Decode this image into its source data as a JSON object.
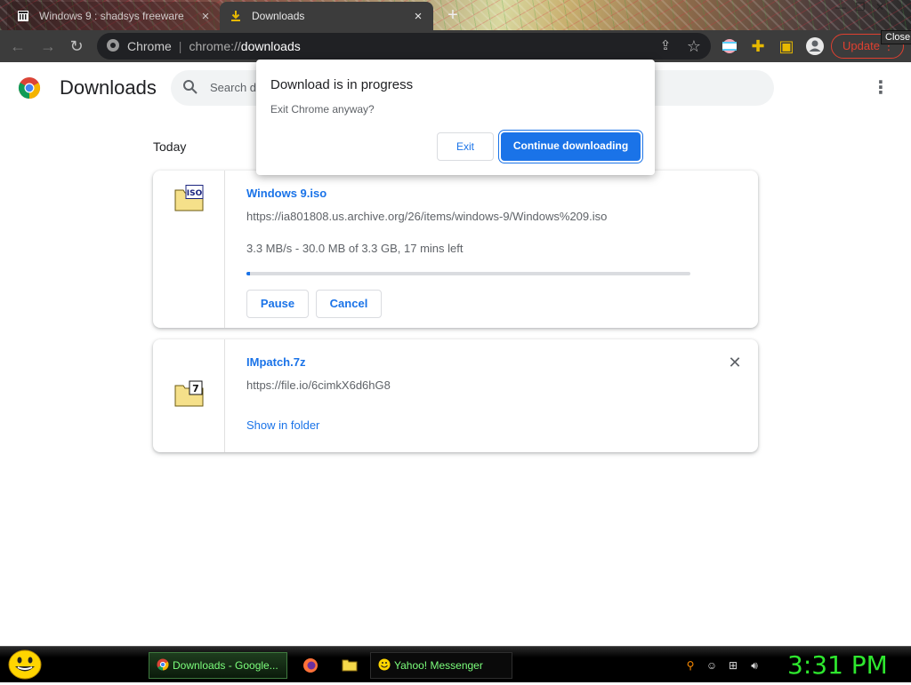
{
  "tabs": [
    {
      "title": "Windows 9 : shadsys freeware",
      "active": false
    },
    {
      "title": "Downloads",
      "active": true
    }
  ],
  "toolbar": {
    "site_label": "Chrome",
    "url_scheme": "chrome://",
    "url_host": "downloads",
    "update_label": "Update",
    "close_tooltip": "Close"
  },
  "page": {
    "title": "Downloads",
    "search_placeholder": "Search downloads",
    "section_label": "Today"
  },
  "downloads": [
    {
      "name": "Windows 9.iso",
      "url": "https://ia801808.us.archive.org/26/items/windows-9/Windows%209.iso",
      "status": "3.3 MB/s - 30.0 MB of 3.3 GB, 17 mins left",
      "progress_fraction": 0.009,
      "icon_label": "ISO",
      "pause_label": "Pause",
      "cancel_label": "Cancel"
    },
    {
      "name": "IMpatch.7z",
      "url": "https://file.io/6cimkX6d6hG8",
      "show_in_folder_label": "Show in folder",
      "icon_label": "7"
    }
  ],
  "dialog": {
    "title": "Download is in progress",
    "message": "Exit Chrome anyway?",
    "exit_label": "Exit",
    "continue_label": "Continue downloading"
  },
  "taskbar": {
    "items": [
      {
        "label": "Downloads - Google..."
      },
      {
        "label": "Yahoo! Messenger"
      }
    ],
    "clock": "3:31 PM"
  },
  "colors": {
    "accent": "#1a73e8",
    "clock": "#2ee62e",
    "update": "#e04030"
  }
}
